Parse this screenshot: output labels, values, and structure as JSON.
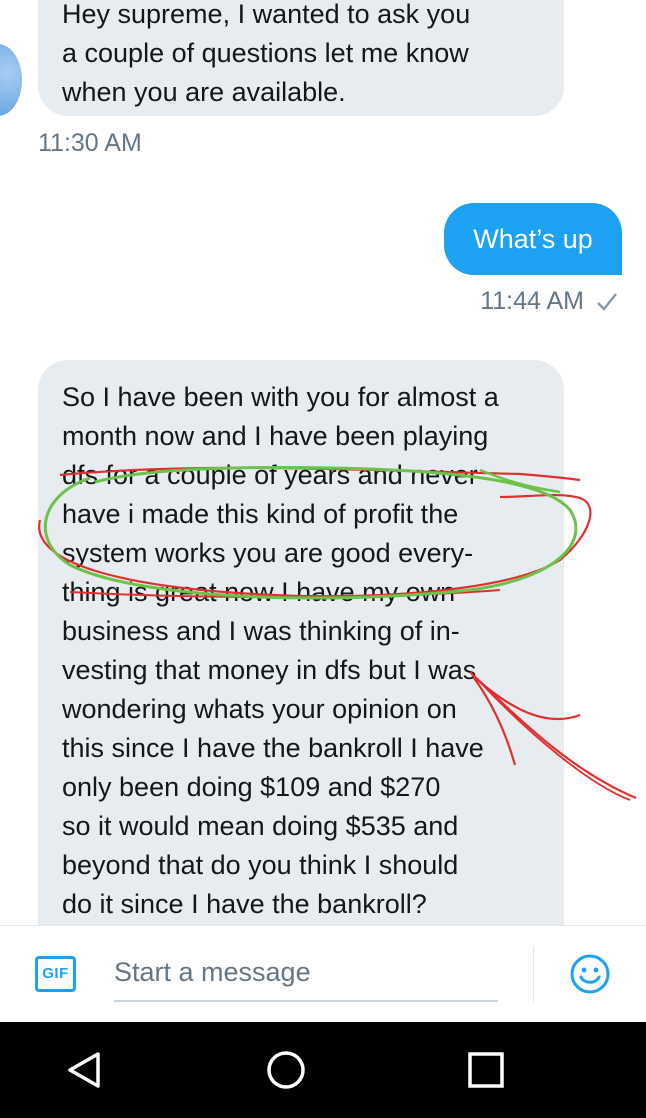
{
  "thread": {
    "messages": [
      {
        "direction": "received",
        "lines": [
          "Hey supreme, I wanted to ask you",
          "a couple of questions let me know",
          "when you are available."
        ],
        "time": "11:30 AM"
      },
      {
        "direction": "sent",
        "text": "What’s up",
        "time": "11:44 AM",
        "status_icon": "checkmark-icon"
      },
      {
        "direction": "received",
        "lines": [
          "So I have been with you for almost a",
          "month now and I have been playing",
          "dfs for a couple of years and never",
          "have i made this kind of profit the",
          "system works you are good every-",
          "thing is great now I have my own",
          "business and I was thinking of in-",
          "vesting that money in dfs but I was",
          "wondering whats your opinion on",
          "this since I have the bankroll I have",
          "only been doing $109 and $270",
          "so it would mean doing $535 and",
          "beyond that do you think I should",
          "do it since I have the bankroll?"
        ]
      }
    ],
    "annotations": {
      "ellipse_color": "#6cc24a",
      "pen_color": "#e0302e"
    }
  },
  "composer": {
    "gif_label": "GIF",
    "placeholder": "Start a message",
    "emoji_icon": "emoji-icon"
  },
  "colors": {
    "accent": "#1da1f2",
    "received_bubble": "#e6ecf0",
    "timestamp": "#657786",
    "nav_bar": "#000000"
  },
  "navbar": {
    "icons": [
      "back-icon",
      "home-icon",
      "recent-apps-icon"
    ]
  }
}
